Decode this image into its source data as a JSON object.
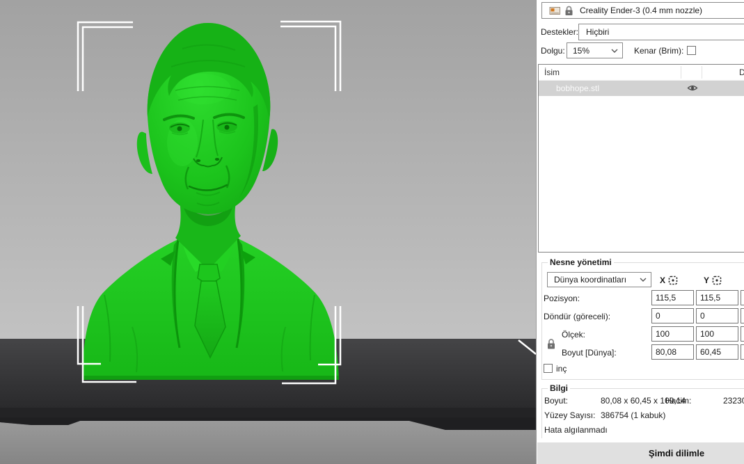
{
  "viewport": {
    "model_color": "#1ec21e",
    "bed_color": "#242426",
    "background_top": "#a2a2a2",
    "background_bottom": "#c2c2c2",
    "selection_box_color": "#ffffff"
  },
  "printer_bar": {
    "printer_name": "Creality Ender-3 (0.4 mm nozzle)"
  },
  "print_settings": {
    "supports_label": "Destekler:",
    "supports_value": "Hiçbiri",
    "infill_label": "Dolgu:",
    "infill_value": "15%",
    "brim_label": "Kenar (Brim):",
    "brim_checked": false
  },
  "object_list": {
    "name_column": "İsim",
    "clipped_column": "D",
    "rows": [
      {
        "name": "bobhope.stl"
      }
    ]
  },
  "manipulation": {
    "title": "Nesne yönetimi",
    "coordinate_system": "Dünya koordinatları",
    "axis_x": "X",
    "axis_y": "Y",
    "rows": [
      {
        "label": "Pozisyon:",
        "x": "115,5",
        "y": "115,5"
      },
      {
        "label": "Döndür (göreceli):",
        "x": "0",
        "y": "0"
      },
      {
        "label": "Ölçek:",
        "x": "100",
        "y": "100"
      },
      {
        "label": "Boyut [Dünya]:",
        "x": "80,08",
        "y": "60,45"
      }
    ],
    "inches_label": "inç",
    "inches_checked": false
  },
  "info": {
    "title": "Bilgi",
    "size_label": "Boyut:",
    "size_value": "80,08 x 60,45 x 109,14",
    "volume_label": "Hacim:",
    "volume_value": "23230",
    "facets_label": "Yüzey Sayısı:",
    "facets_value": "386754 (1 kabuk)",
    "errors_text": "Hata algılanmadı"
  },
  "actions": {
    "slice_button": "Şimdi dilimle"
  }
}
